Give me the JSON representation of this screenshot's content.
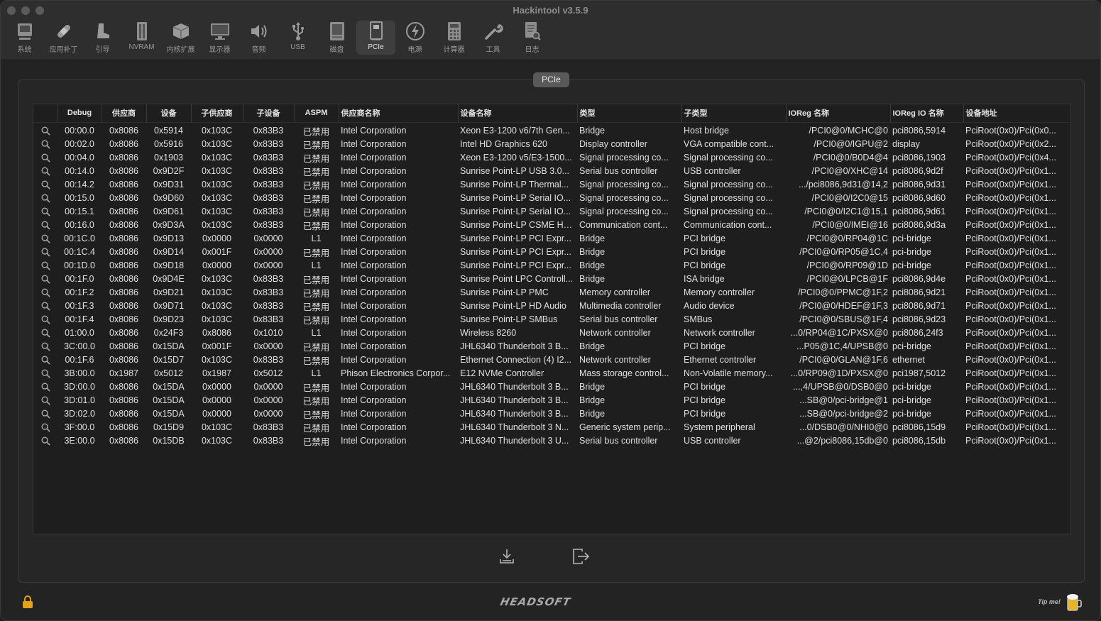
{
  "app": {
    "title": "Hackintool v3.5.9"
  },
  "toolbar": [
    {
      "label": "系统",
      "icon": "system-icon"
    },
    {
      "label": "应用补丁",
      "icon": "patch-icon"
    },
    {
      "label": "引导",
      "icon": "boot-icon"
    },
    {
      "label": "NVRAM",
      "icon": "nvram-icon"
    },
    {
      "label": "内核扩展",
      "icon": "kext-icon"
    },
    {
      "label": "显示器",
      "icon": "display-icon"
    },
    {
      "label": "音频",
      "icon": "audio-icon"
    },
    {
      "label": "USB",
      "icon": "usb-icon"
    },
    {
      "label": "磁盘",
      "icon": "disk-icon"
    },
    {
      "label": "PCIe",
      "icon": "pcie-icon",
      "active": true
    },
    {
      "label": "电源",
      "icon": "power-icon"
    },
    {
      "label": "计算器",
      "icon": "calculator-icon"
    },
    {
      "label": "工具",
      "icon": "tools-icon"
    },
    {
      "label": "日志",
      "icon": "log-icon"
    }
  ],
  "panel": {
    "tab_label": "PCIe"
  },
  "table": {
    "columns": [
      "",
      "Debug",
      "供应商",
      "设备",
      "子供应商",
      "子设备",
      "ASPM",
      "供应商名称",
      "设备名称",
      "类型",
      "子类型",
      "IOReg 名称",
      "IOReg IO 名称",
      "设备地址"
    ],
    "rows": [
      [
        "00:00.0",
        "0x8086",
        "0x5914",
        "0x103C",
        "0x83B3",
        "已禁用",
        "Intel Corporation",
        "Xeon E3-1200 v6/7th Gen...",
        "Bridge",
        "Host bridge",
        "/PCI0@0/MCHC@0",
        "pci8086,5914",
        "PciRoot(0x0)/Pci(0x0..."
      ],
      [
        "00:02.0",
        "0x8086",
        "0x5916",
        "0x103C",
        "0x83B3",
        "已禁用",
        "Intel Corporation",
        "Intel HD Graphics 620",
        "Display controller",
        "VGA compatible cont...",
        "/PCI0@0/IGPU@2",
        "display",
        "PciRoot(0x0)/Pci(0x2..."
      ],
      [
        "00:04.0",
        "0x8086",
        "0x1903",
        "0x103C",
        "0x83B3",
        "已禁用",
        "Intel Corporation",
        "Xeon E3-1200 v5/E3-1500...",
        "Signal processing co...",
        "Signal processing co...",
        "/PCI0@0/B0D4@4",
        "pci8086,1903",
        "PciRoot(0x0)/Pci(0x4..."
      ],
      [
        "00:14.0",
        "0x8086",
        "0x9D2F",
        "0x103C",
        "0x83B3",
        "已禁用",
        "Intel Corporation",
        "Sunrise Point-LP USB 3.0...",
        "Serial bus controller",
        "USB controller",
        "/PCI0@0/XHC@14",
        "pci8086,9d2f",
        "PciRoot(0x0)/Pci(0x1..."
      ],
      [
        "00:14.2",
        "0x8086",
        "0x9D31",
        "0x103C",
        "0x83B3",
        "已禁用",
        "Intel Corporation",
        "Sunrise Point-LP Thermal...",
        "Signal processing co...",
        "Signal processing co...",
        ".../pci8086,9d31@14,2",
        "pci8086,9d31",
        "PciRoot(0x0)/Pci(0x1..."
      ],
      [
        "00:15.0",
        "0x8086",
        "0x9D60",
        "0x103C",
        "0x83B3",
        "已禁用",
        "Intel Corporation",
        "Sunrise Point-LP Serial IO...",
        "Signal processing co...",
        "Signal processing co...",
        "/PCI0@0/I2C0@15",
        "pci8086,9d60",
        "PciRoot(0x0)/Pci(0x1..."
      ],
      [
        "00:15.1",
        "0x8086",
        "0x9D61",
        "0x103C",
        "0x83B3",
        "已禁用",
        "Intel Corporation",
        "Sunrise Point-LP Serial IO...",
        "Signal processing co...",
        "Signal processing co...",
        "/PCI0@0/I2C1@15,1",
        "pci8086,9d61",
        "PciRoot(0x0)/Pci(0x1..."
      ],
      [
        "00:16.0",
        "0x8086",
        "0x9D3A",
        "0x103C",
        "0x83B3",
        "已禁用",
        "Intel Corporation",
        "Sunrise Point-LP CSME HE...",
        "Communication cont...",
        "Communication cont...",
        "/PCI0@0/IMEI@16",
        "pci8086,9d3a",
        "PciRoot(0x0)/Pci(0x1..."
      ],
      [
        "00:1C.0",
        "0x8086",
        "0x9D13",
        "0x0000",
        "0x0000",
        "L1",
        "Intel Corporation",
        "Sunrise Point-LP PCI Expr...",
        "Bridge",
        "PCI bridge",
        "/PCI0@0/RP04@1C",
        "pci-bridge",
        "PciRoot(0x0)/Pci(0x1..."
      ],
      [
        "00:1C.4",
        "0x8086",
        "0x9D14",
        "0x001F",
        "0x0000",
        "已禁用",
        "Intel Corporation",
        "Sunrise Point-LP PCI Expr...",
        "Bridge",
        "PCI bridge",
        "/PCI0@0/RP05@1C,4",
        "pci-bridge",
        "PciRoot(0x0)/Pci(0x1..."
      ],
      [
        "00:1D.0",
        "0x8086",
        "0x9D18",
        "0x0000",
        "0x0000",
        "L1",
        "Intel Corporation",
        "Sunrise Point-LP PCI Expr...",
        "Bridge",
        "PCI bridge",
        "/PCI0@0/RP09@1D",
        "pci-bridge",
        "PciRoot(0x0)/Pci(0x1..."
      ],
      [
        "00:1F.0",
        "0x8086",
        "0x9D4E",
        "0x103C",
        "0x83B3",
        "已禁用",
        "Intel Corporation",
        "Sunrise Point LPC Controll...",
        "Bridge",
        "ISA bridge",
        "/PCI0@0/LPCB@1F",
        "pci8086,9d4e",
        "PciRoot(0x0)/Pci(0x1..."
      ],
      [
        "00:1F.2",
        "0x8086",
        "0x9D21",
        "0x103C",
        "0x83B3",
        "已禁用",
        "Intel Corporation",
        "Sunrise Point-LP PMC",
        "Memory controller",
        "Memory controller",
        "/PCI0@0/PPMC@1F,2",
        "pci8086,9d21",
        "PciRoot(0x0)/Pci(0x1..."
      ],
      [
        "00:1F.3",
        "0x8086",
        "0x9D71",
        "0x103C",
        "0x83B3",
        "已禁用",
        "Intel Corporation",
        "Sunrise Point-LP HD Audio",
        "Multimedia controller",
        "Audio device",
        "/PCI0@0/HDEF@1F,3",
        "pci8086,9d71",
        "PciRoot(0x0)/Pci(0x1..."
      ],
      [
        "00:1F.4",
        "0x8086",
        "0x9D23",
        "0x103C",
        "0x83B3",
        "已禁用",
        "Intel Corporation",
        "Sunrise Point-LP SMBus",
        "Serial bus controller",
        "SMBus",
        "/PCI0@0/SBUS@1F,4",
        "pci8086,9d23",
        "PciRoot(0x0)/Pci(0x1..."
      ],
      [
        "01:00.0",
        "0x8086",
        "0x24F3",
        "0x8086",
        "0x1010",
        "L1",
        "Intel Corporation",
        "Wireless 8260",
        "Network controller",
        "Network controller",
        "...0/RP04@1C/PXSX@0",
        "pci8086,24f3",
        "PciRoot(0x0)/Pci(0x1..."
      ],
      [
        "3C:00.0",
        "0x8086",
        "0x15DA",
        "0x001F",
        "0x0000",
        "已禁用",
        "Intel Corporation",
        "JHL6340 Thunderbolt 3 B...",
        "Bridge",
        "PCI bridge",
        "...P05@1C,4/UPSB@0",
        "pci-bridge",
        "PciRoot(0x0)/Pci(0x1..."
      ],
      [
        "00:1F.6",
        "0x8086",
        "0x15D7",
        "0x103C",
        "0x83B3",
        "已禁用",
        "Intel Corporation",
        "Ethernet Connection (4) I2...",
        "Network controller",
        "Ethernet controller",
        "/PCI0@0/GLAN@1F,6",
        "ethernet",
        "PciRoot(0x0)/Pci(0x1..."
      ],
      [
        "3B:00.0",
        "0x1987",
        "0x5012",
        "0x1987",
        "0x5012",
        "L1",
        "Phison Electronics Corpor...",
        "E12 NVMe Controller",
        "Mass storage control...",
        "Non-Volatile memory...",
        "...0/RP09@1D/PXSX@0",
        "pci1987,5012",
        "PciRoot(0x0)/Pci(0x1..."
      ],
      [
        "3D:00.0",
        "0x8086",
        "0x15DA",
        "0x0000",
        "0x0000",
        "已禁用",
        "Intel Corporation",
        "JHL6340 Thunderbolt 3 B...",
        "Bridge",
        "PCI bridge",
        "...,4/UPSB@0/DSB0@0",
        "pci-bridge",
        "PciRoot(0x0)/Pci(0x1..."
      ],
      [
        "3D:01.0",
        "0x8086",
        "0x15DA",
        "0x0000",
        "0x0000",
        "已禁用",
        "Intel Corporation",
        "JHL6340 Thunderbolt 3 B...",
        "Bridge",
        "PCI bridge",
        "...SB@0/pci-bridge@1",
        "pci-bridge",
        "PciRoot(0x0)/Pci(0x1..."
      ],
      [
        "3D:02.0",
        "0x8086",
        "0x15DA",
        "0x0000",
        "0x0000",
        "已禁用",
        "Intel Corporation",
        "JHL6340 Thunderbolt 3 B...",
        "Bridge",
        "PCI bridge",
        "...SB@0/pci-bridge@2",
        "pci-bridge",
        "PciRoot(0x0)/Pci(0x1..."
      ],
      [
        "3F:00.0",
        "0x8086",
        "0x15D9",
        "0x103C",
        "0x83B3",
        "已禁用",
        "Intel Corporation",
        "JHL6340 Thunderbolt 3 N...",
        "Generic system perip...",
        "System peripheral",
        "...0/DSB0@0/NHI0@0",
        "pci8086,15d9",
        "PciRoot(0x0)/Pci(0x1..."
      ],
      [
        "3E:00.0",
        "0x8086",
        "0x15DB",
        "0x103C",
        "0x83B3",
        "已禁用",
        "Intel Corporation",
        "JHL6340 Thunderbolt 3 U...",
        "Serial bus controller",
        "USB controller",
        "...@2/pci8086,15db@0",
        "pci8086,15db",
        "PciRoot(0x0)/Pci(0x1..."
      ]
    ]
  },
  "footer": {
    "brand": "HEADSOFT",
    "tip": "Tip me!",
    "export_icon": "export-icon",
    "quit_icon": "quit-icon",
    "lock_icon": "lock-icon"
  }
}
